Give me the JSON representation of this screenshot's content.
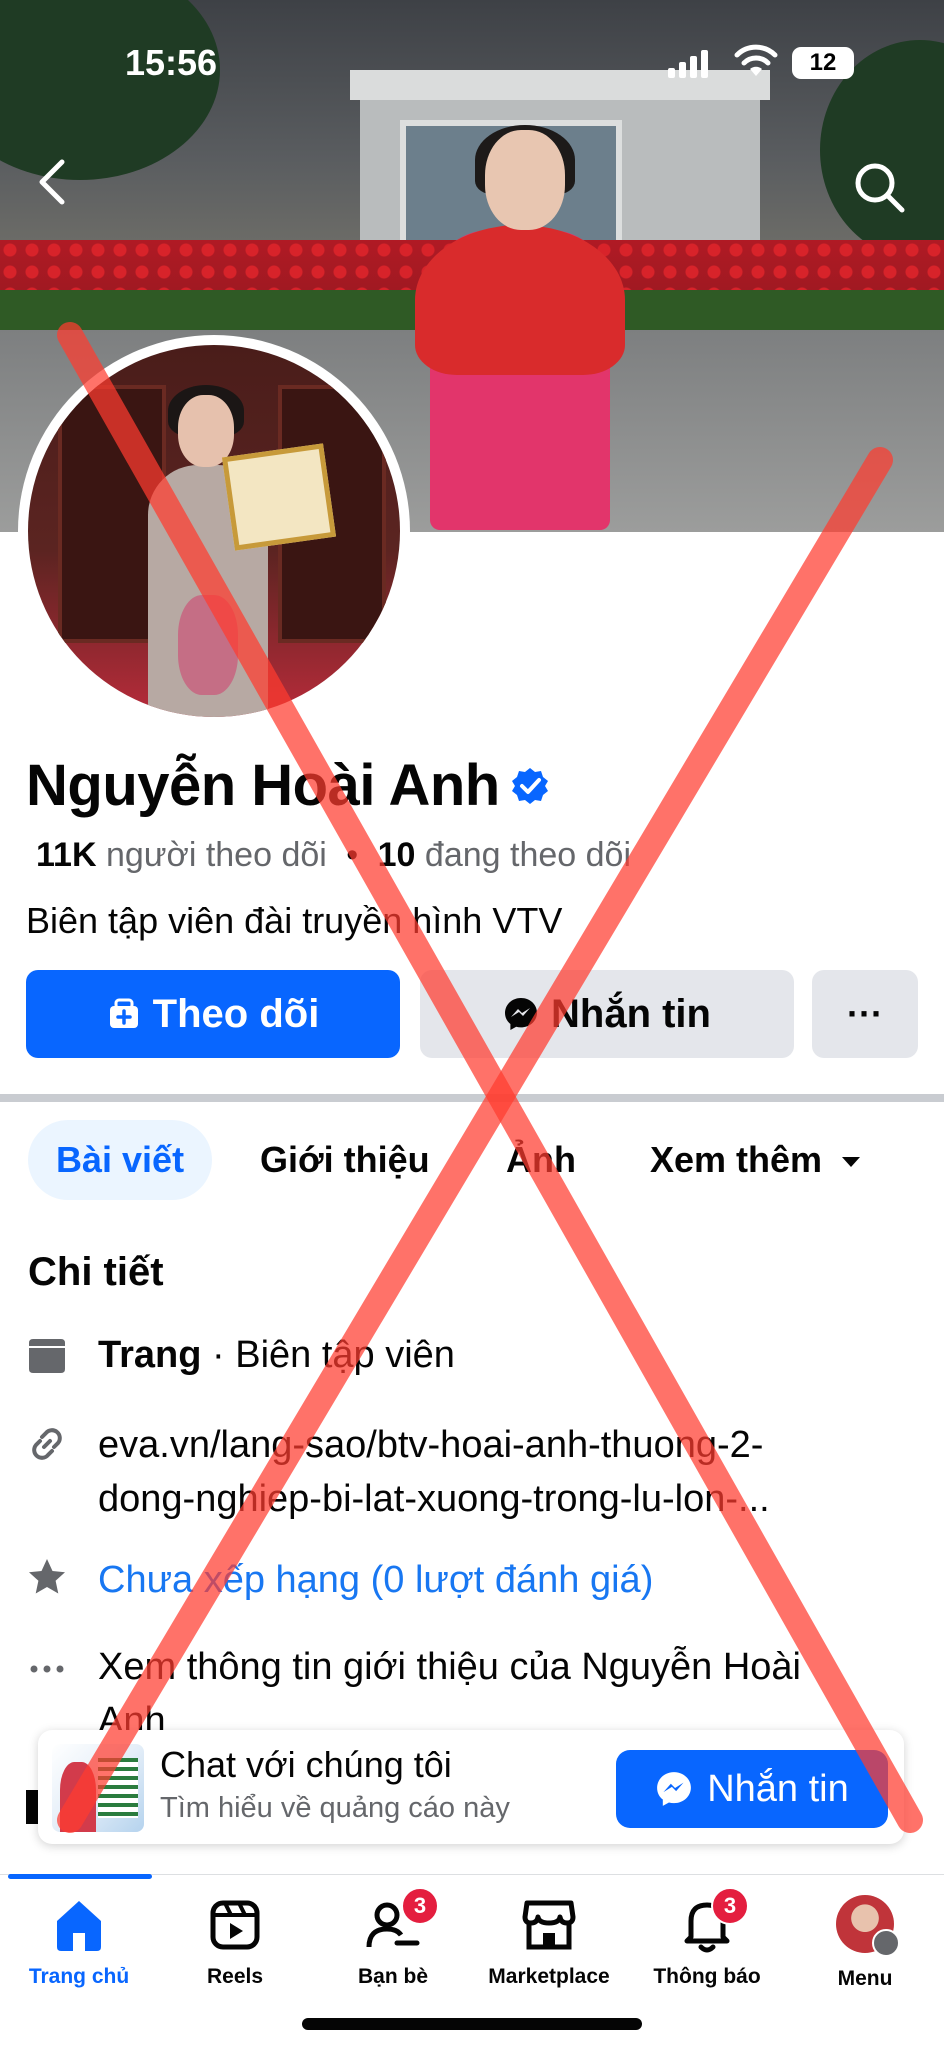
{
  "status_bar": {
    "time": "15:56",
    "battery": "12"
  },
  "profile": {
    "name": "Nguyễn Hoài Anh",
    "followers_count": "11K",
    "followers_label": "người theo dõi",
    "separator": "•",
    "following_count": "10",
    "following_label": "đang theo dõi",
    "bio": "Biên tập viên đài truyền hình VTV"
  },
  "actions": {
    "follow_label": "Theo dõi",
    "message_label": "Nhắn tin",
    "more_label": "···"
  },
  "tabs": [
    {
      "label": "Bài viết"
    },
    {
      "label": "Giới thiệu"
    },
    {
      "label": "Ảnh"
    },
    {
      "label": "Xem thêm"
    }
  ],
  "details": {
    "title": "Chi tiết",
    "category_strong": "Trang",
    "category_rest": " · Biên tập viên",
    "link_line1": "eva.vn/lang-sao/btv-hoai-anh-thuong-2-",
    "link_line2": "dong-nghiep-bi-lat-xuong-trong-lu-lon-...",
    "rating": "Chưa xếp hạng (0 lượt đánh giá)",
    "see_more_line1": "Xem thông tin giới thiệu của Nguyễn Hoài",
    "see_more_line2": "Anh"
  },
  "ad": {
    "title": "Chat với chúng tôi",
    "subtitle": "Tìm hiểu về quảng cáo này",
    "button_label": "Nhắn tin"
  },
  "bottom_nav": [
    {
      "label": "Trang chủ",
      "icon": "home-icon"
    },
    {
      "label": "Reels",
      "icon": "reels-icon"
    },
    {
      "label": "Bạn bè",
      "icon": "friends-icon",
      "badge": "3"
    },
    {
      "label": "Marketplace",
      "icon": "marketplace-icon"
    },
    {
      "label": "Thông báo",
      "icon": "bell-icon",
      "badge": "3"
    },
    {
      "label": "Menu",
      "icon": "menu-avatar"
    }
  ],
  "colors": {
    "primary": "#0866ff",
    "overlay_x": "#ff3b2f",
    "badge": "#e41e3f"
  }
}
